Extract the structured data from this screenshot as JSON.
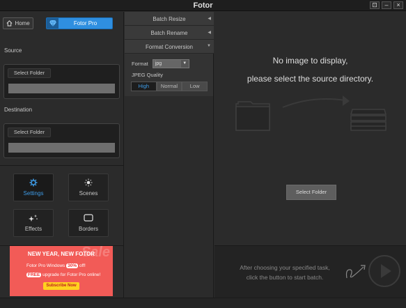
{
  "window": {
    "title": "Fotor",
    "controls": {
      "restore": "⊡",
      "minimize": "–",
      "close": "×"
    }
  },
  "left": {
    "home_label": "Home",
    "pro_label": "Fotor Pro",
    "source_label": "Source",
    "source_select": "Select Folder",
    "destination_label": "Destination",
    "destination_select": "Select Folder",
    "tools": [
      {
        "label": "Settings",
        "icon": "gear-icon",
        "active": true
      },
      {
        "label": "Scenes",
        "icon": "sun-icon",
        "active": false
      },
      {
        "label": "Effects",
        "icon": "sparkle-icon",
        "active": false
      },
      {
        "label": "Borders",
        "icon": "border-icon",
        "active": false
      }
    ],
    "ad": {
      "headline": "NEW YEAR, NEW FOTOR",
      "line1_pre": "Fotor Pro Windows",
      "line1_pct": "30%",
      "line1_post": "off!",
      "line2_free": "FREE",
      "line2_post": "upgrade for Fotor Pro online!",
      "cta": "Subscribe Now",
      "watermark": "Sale",
      "background": "#f25b57"
    }
  },
  "middle": {
    "batch_resize": "Batch Resize",
    "batch_rename": "Batch Rename",
    "format_conversion": "Format Conversion",
    "format_label": "Format",
    "format_value": "jpg",
    "jpeg_quality_label": "JPEG Quality",
    "quality_options": [
      "High",
      "Normal",
      "Low"
    ],
    "quality_selected": "High"
  },
  "main": {
    "no_image_line1": "No image to display,",
    "no_image_line2": "please select the source directory.",
    "select_folder": "Select Folder",
    "start_hint_line1": "After choosing your specified task,",
    "start_hint_line2": "click the button to start batch."
  },
  "colors": {
    "accent": "#3e9ce8",
    "pro_button": "#2f8fe0"
  }
}
